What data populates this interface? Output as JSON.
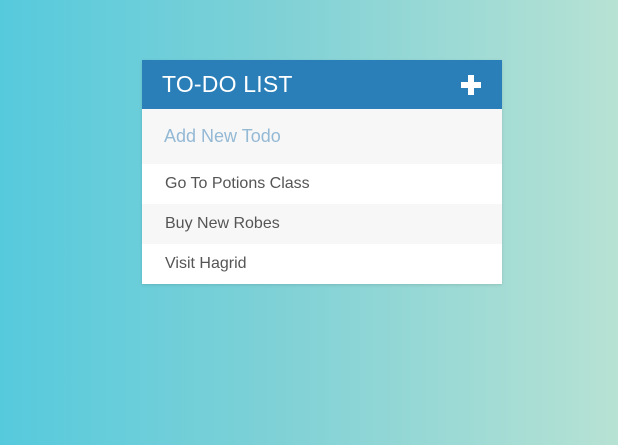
{
  "todo": {
    "title": "TO-DO LIST",
    "add_icon": "plus-icon",
    "input_placeholder": "Add New Todo",
    "items": [
      {
        "label": "Go To Potions Class"
      },
      {
        "label": "Buy New Robes"
      },
      {
        "label": "Visit Hagrid"
      }
    ]
  },
  "colors": {
    "header": "#2a7fb8",
    "background_start": "#56cadd",
    "background_end": "#b7e2d4",
    "placeholder": "#94b9d5",
    "item_text": "#555555"
  }
}
